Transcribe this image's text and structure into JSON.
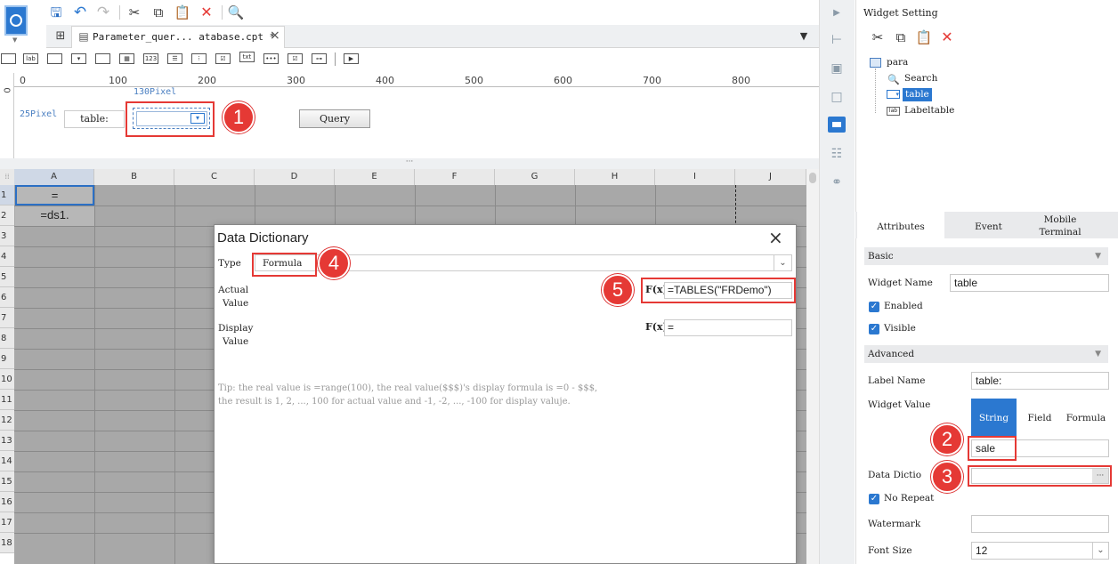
{
  "toolbar": {
    "save": "save-icon",
    "undo": "undo-icon",
    "redo": "redo-icon",
    "cut": "cut-icon",
    "copy": "copy-icon",
    "paste": "paste-icon",
    "delete": "delete-icon",
    "preview": "preview-icon"
  },
  "tab": {
    "title": "Parameter_quer... atabase.cpt *",
    "close": "×"
  },
  "widget_bar": {
    "items": [
      "lab",
      "123",
      "txt"
    ]
  },
  "ruler": {
    "ticks": [
      "0",
      "100",
      "200",
      "300",
      "400",
      "500",
      "600",
      "700",
      "800"
    ],
    "v_zero": "0",
    "width_note": "130Pixel",
    "height_note": "25Pixel"
  },
  "param_pane": {
    "label": "table:",
    "query_button": "Query"
  },
  "sheet": {
    "columns": [
      "A",
      "B",
      "C",
      "D",
      "E",
      "F",
      "G",
      "H",
      "I",
      "J"
    ],
    "rows": [
      "1",
      "2",
      "3",
      "4",
      "5",
      "6",
      "7",
      "8",
      "9",
      "10",
      "11",
      "12",
      "13",
      "14",
      "15",
      "16",
      "17",
      "18"
    ],
    "a1": "=",
    "a2": "=ds1."
  },
  "dialog": {
    "title": "Data Dictionary",
    "close": "×",
    "type_label": "Type",
    "type_value": "Formula",
    "actual_label_1": "Actual",
    "actual_label_2": "Value",
    "actual_value": "=TABLES(\"FRDemo\")",
    "display_label_1": "Display",
    "display_label_2": "Value",
    "display_value": "=",
    "fx": "F(x)",
    "tip_1": "Tip: the real value is =range(100), the real value($$$)'s display formula is =0 - $$$,",
    "tip_2": "the result is 1, 2, ..., 100 for actual value and -1, -2, ..., -100 for display valuje."
  },
  "badges": [
    "1",
    "2",
    "3",
    "4",
    "5"
  ],
  "panel": {
    "title": "Widget Setting",
    "tree": {
      "root": "para",
      "items": [
        "Search",
        "table",
        "Labeltable"
      ]
    },
    "tabs": [
      "Attributes",
      "Event",
      "Mobile Terminal"
    ],
    "basic": "Basic",
    "widget_name_label": "Widget Name",
    "widget_name_value": "table",
    "enabled": "Enabled",
    "visible": "Visible",
    "advanced": "Advanced",
    "label_name_label": "Label Name",
    "label_name_value": "table:",
    "widget_value_label": "Widget Value",
    "value_types": [
      "String",
      "Field",
      "Formula"
    ],
    "widget_value": "sale",
    "data_dict_label": "Data Dictio",
    "data_dict_btn": "···",
    "no_repeat": "No Repeat",
    "watermark_label": "Watermark",
    "font_size_label": "Font Size",
    "font_size_value": "12"
  },
  "colors": {
    "accent": "#2b78d0",
    "badge": "#e53935"
  }
}
